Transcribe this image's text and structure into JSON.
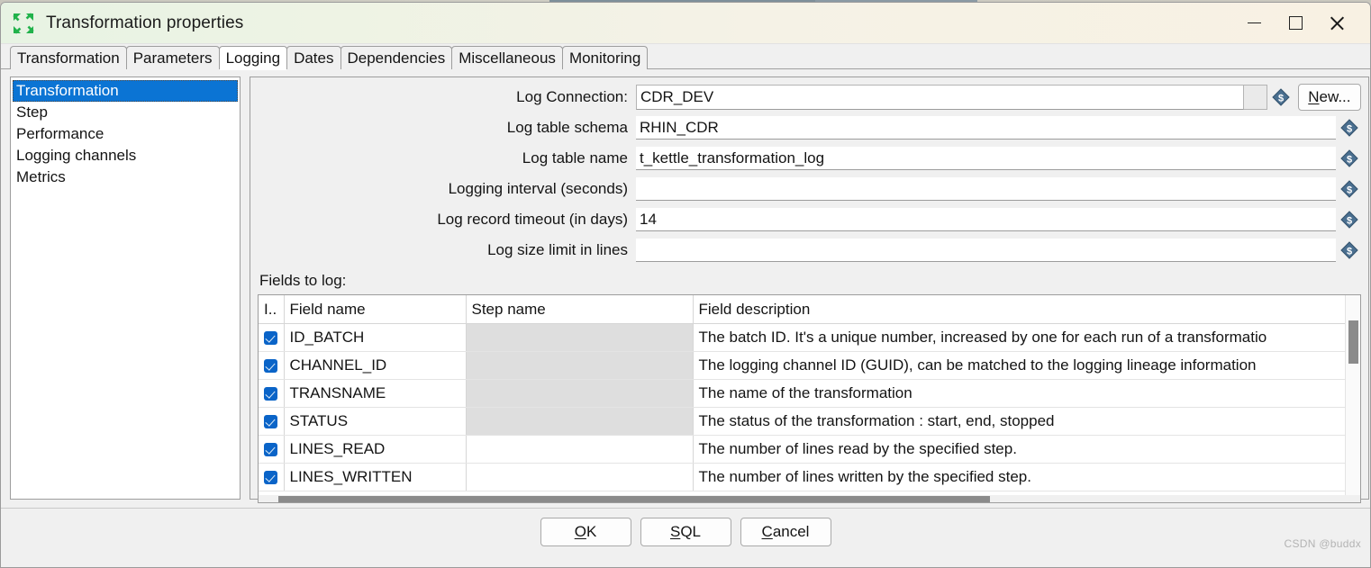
{
  "window": {
    "title": "Transformation properties",
    "app_icon": "transform-collapse-arrows-icon",
    "controls": {
      "minimize": "minimize-icon",
      "maximize": "maximize-icon",
      "close": "close-icon"
    }
  },
  "tabs": [
    {
      "label": "Transformation",
      "active": false
    },
    {
      "label": "Parameters",
      "active": false
    },
    {
      "label": "Logging",
      "active": true
    },
    {
      "label": "Dates",
      "active": false
    },
    {
      "label": "Dependencies",
      "active": false
    },
    {
      "label": "Miscellaneous",
      "active": false
    },
    {
      "label": "Monitoring",
      "active": false
    }
  ],
  "sidebar": {
    "items": [
      {
        "label": "Transformation",
        "selected": true
      },
      {
        "label": "Step",
        "selected": false
      },
      {
        "label": "Performance",
        "selected": false
      },
      {
        "label": "Logging channels",
        "selected": false
      },
      {
        "label": "Metrics",
        "selected": false
      }
    ]
  },
  "form": {
    "rows": [
      {
        "label": "Log Connection:",
        "value": "CDR_DEV",
        "placeholder": "",
        "type": "combo",
        "has_variable_icon": true,
        "has_new_button": true
      },
      {
        "label": "Log table schema",
        "value": "RHIN_CDR",
        "placeholder": "",
        "type": "text",
        "has_variable_icon": true,
        "has_new_button": false
      },
      {
        "label": "Log table name",
        "value": "t_kettle_transformation_log",
        "placeholder": "",
        "type": "text",
        "has_variable_icon": true,
        "has_new_button": false
      },
      {
        "label": "Logging interval (seconds)",
        "value": "",
        "placeholder": "",
        "type": "text",
        "has_variable_icon": true,
        "has_new_button": false
      },
      {
        "label": "Log record timeout (in days)",
        "value": "14",
        "placeholder": "",
        "type": "text",
        "has_variable_icon": true,
        "has_new_button": false
      },
      {
        "label": "Log size limit in lines",
        "value": "",
        "placeholder": "",
        "type": "text",
        "has_variable_icon": true,
        "has_new_button": false
      }
    ],
    "new_button_label": "New...",
    "new_button_mnemonic": "N",
    "variable_icon": "dollar-variable-diamond-icon",
    "fields_to_log_label": "Fields to log:"
  },
  "table": {
    "headers": [
      "I..",
      "Field name",
      "Step name",
      "Field description"
    ],
    "rows": [
      {
        "checked": true,
        "field_name": "ID_BATCH",
        "step_name": "",
        "step_greyed": true,
        "description": "The batch ID. It's a unique number, increased by one for each run of a transformatio"
      },
      {
        "checked": true,
        "field_name": "CHANNEL_ID",
        "step_name": "",
        "step_greyed": true,
        "description": "The logging channel ID (GUID), can be matched to the logging lineage information"
      },
      {
        "checked": true,
        "field_name": "TRANSNAME",
        "step_name": "",
        "step_greyed": true,
        "description": "The name of the transformation"
      },
      {
        "checked": true,
        "field_name": "STATUS",
        "step_name": "",
        "step_greyed": true,
        "description": "The status of the transformation : start, end, stopped"
      },
      {
        "checked": true,
        "field_name": "LINES_READ",
        "step_name": "",
        "step_greyed": false,
        "description": "The number of lines read by the specified step."
      },
      {
        "checked": true,
        "field_name": "LINES_WRITTEN",
        "step_name": "",
        "step_greyed": false,
        "description": "The number of lines written by the specified step."
      }
    ]
  },
  "footer": {
    "buttons": [
      {
        "label": "OK",
        "mnemonic": "O"
      },
      {
        "label": "SQL",
        "mnemonic": "S"
      },
      {
        "label": "Cancel",
        "mnemonic": "C"
      }
    ]
  },
  "watermark": "CSDN @buddx",
  "colors": {
    "selection_blue": "#0b74d4",
    "checkbox_blue": "#0a64c8",
    "titlebar_green": "#e7f3e3",
    "titlebar_cream": "#f8f1e3",
    "scrollbar_grey": "#8b8b8b"
  }
}
